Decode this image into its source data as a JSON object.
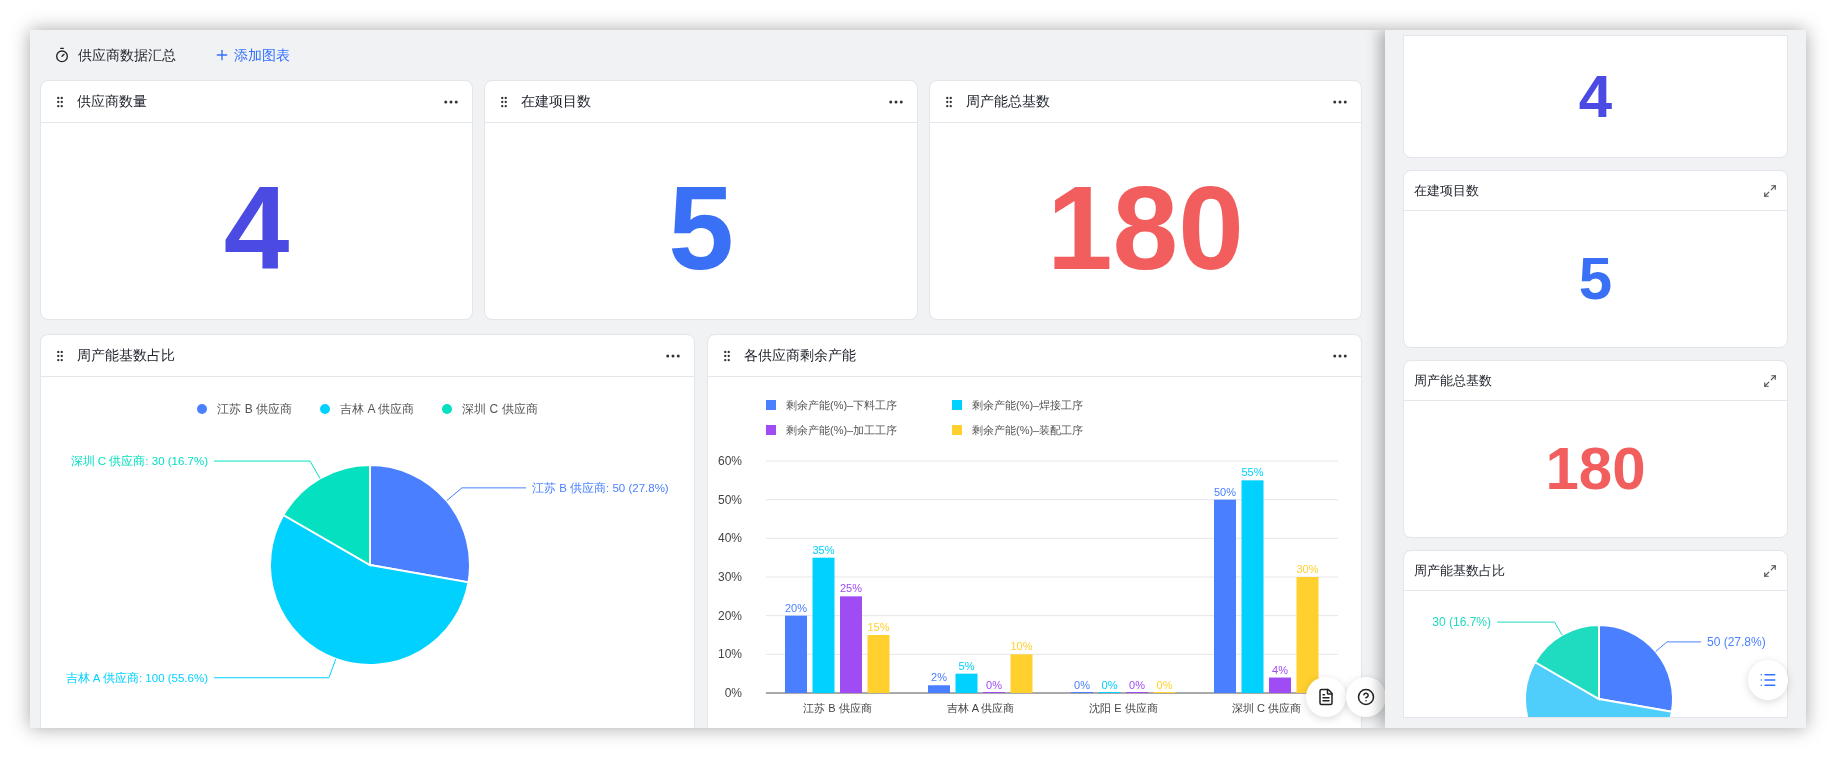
{
  "header": {
    "title": "供应商数据汇总",
    "add_button": "添加图表"
  },
  "stat_cards": [
    {
      "title": "供应商数量",
      "value": "4",
      "color": "#4b4be3"
    },
    {
      "title": "在建项目数",
      "value": "5",
      "color": "#3a70f5"
    },
    {
      "title": "周产能总基数",
      "value": "180",
      "color": "#f25e5e"
    }
  ],
  "pie_card": {
    "title": "周产能基数占比",
    "chart_data": {
      "type": "pie",
      "categories": [
        "江苏 B 供应商",
        "吉林 A 供应商",
        "深圳 C 供应商"
      ],
      "colors": [
        "#4a80ff",
        "#00d1ff",
        "#05e0c0"
      ],
      "values": [
        50,
        100,
        30
      ],
      "value_labels": [
        "江苏 B 供应商: 50 (27.8%)",
        "吉林 A 供应商: 100 (55.6%)",
        "深圳 C 供应商: 30 (16.7%)"
      ]
    }
  },
  "bar_card": {
    "title": "各供应商剩余产能",
    "chart_data": {
      "type": "bar",
      "categories": [
        "江苏 B 供应商",
        "吉林 A 供应商",
        "沈阳 E 供应商",
        "深圳 C 供应商"
      ],
      "series": [
        {
          "name": "剩余产能(%)–下料工序",
          "color": "#4a80ff",
          "values": [
            20,
            2,
            0,
            50
          ],
          "value_labels": [
            "20%",
            "2%",
            "0%",
            "50%"
          ]
        },
        {
          "name": "剩余产能(%)–焊接工序",
          "color": "#00d1ff",
          "values": [
            35,
            5,
            0,
            55
          ],
          "value_labels": [
            "35%",
            "5%",
            "0%",
            "55%"
          ]
        },
        {
          "name": "剩余产能(%)–加工工序",
          "color": "#a04cf5",
          "values": [
            25,
            0,
            0,
            4
          ],
          "value_labels": [
            "25%",
            "0%",
            "0%",
            "4%"
          ]
        },
        {
          "name": "剩余产能(%)–装配工序",
          "color": "#ffd02e",
          "values": [
            15,
            10,
            0,
            30
          ],
          "value_labels": [
            "15%",
            "10%",
            "0%",
            "30%"
          ]
        }
      ],
      "grid": true,
      "ylim": [
        0,
        60
      ],
      "yticks": [
        {
          "value": 0,
          "label": "0%"
        },
        {
          "value": 10,
          "label": "10%"
        },
        {
          "value": 20,
          "label": "20%"
        },
        {
          "value": 30,
          "label": "30%"
        },
        {
          "value": 40,
          "label": "40%"
        },
        {
          "value": 50,
          "label": "50%"
        },
        {
          "value": 60,
          "label": "60%"
        }
      ],
      "data_labels": true
    }
  },
  "side_panel": {
    "cards": [
      {
        "kind": "stat",
        "value": "4",
        "color": "#4b4be3"
      },
      {
        "kind": "stat",
        "title": "在建项目数",
        "value": "5",
        "color": "#3a70f5"
      },
      {
        "kind": "stat",
        "title": "周产能总基数",
        "value": "180",
        "color": "#f25e5e"
      },
      {
        "kind": "pie",
        "title": "周产能基数占比",
        "chart_data": {
          "type": "pie",
          "values": [
            50,
            100,
            30
          ],
          "colors": [
            "#4a80ff",
            "#4fcdfb",
            "#1fdbc0"
          ],
          "value_labels": [
            "50 (27.8%)",
            null,
            "30 (16.7%)"
          ]
        }
      }
    ]
  }
}
